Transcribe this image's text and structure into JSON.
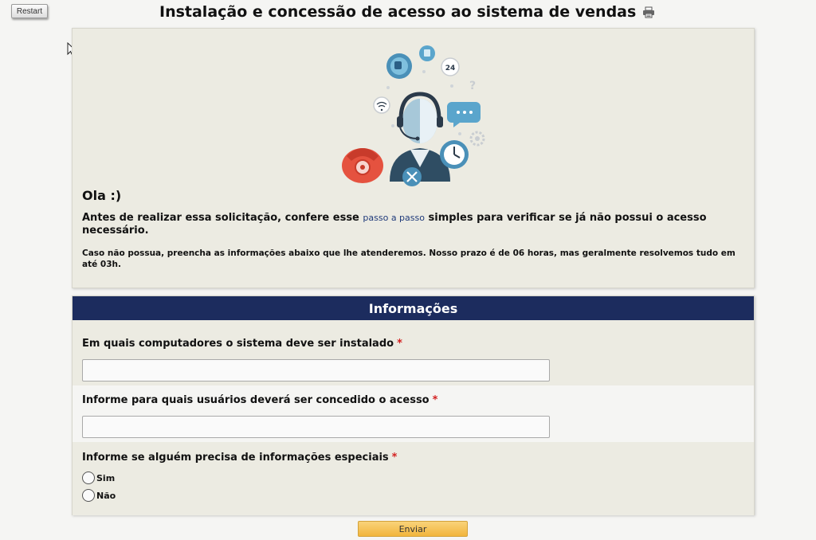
{
  "toolbar": {
    "restart_label": "Restart"
  },
  "header": {
    "title": "Instalação e concessão de acesso ao sistema de vendas",
    "print_icon": "printer-icon"
  },
  "intro": {
    "greeting": "Ola :)",
    "line_before_link": "Antes de realizar essa solicitação, confere esse ",
    "link_text": "passo a passo",
    "line_after_link": " simples para verificar se já não possui o acesso necessário.",
    "note": "Caso não possua, preencha as informações abaixo que lhe atenderemos. Nosso prazo é de 06 horas, mas geralmente resolvemos tudo em até 03h."
  },
  "form": {
    "section_title": "Informações",
    "required_marker": "*",
    "questions": [
      {
        "label": "Em quais computadores o sistema deve ser instalado",
        "value": ""
      },
      {
        "label": "Informe para quais usuários deverá ser concedido o acesso",
        "value": ""
      },
      {
        "label": "Informe se alguém precisa de informações especiais",
        "options": [
          "Sim",
          "Não"
        ]
      }
    ],
    "submit_label": "Enviar"
  },
  "colors": {
    "header_bg": "#1c2c5e",
    "panel_bg": "#ecebe2",
    "required": "#d32020",
    "submit": "#f2b53c"
  }
}
